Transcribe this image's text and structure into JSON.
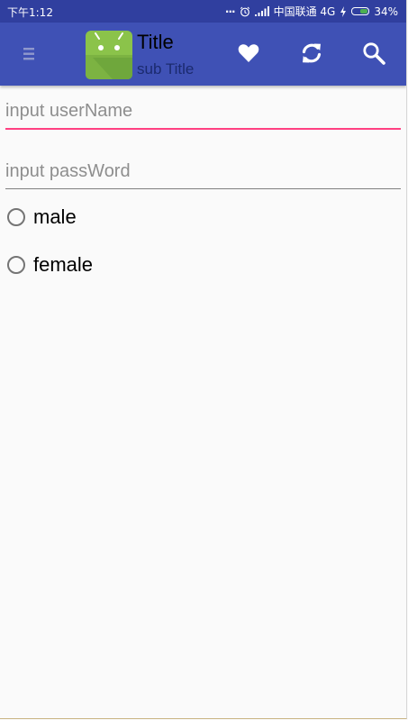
{
  "status_bar": {
    "time": "下午1:12",
    "dots": "...",
    "carrier": "中国联通 4G",
    "battery": "34%",
    "battery_level": 0.34,
    "icons": [
      "alarm-icon",
      "signal-icon",
      "charging-icon",
      "battery-icon"
    ]
  },
  "toolbar": {
    "title": "Title",
    "subtitle": "sub Title",
    "nav_icon": "menu-icon",
    "logo": "android-logo",
    "actions": [
      "heart-icon",
      "refresh-icon",
      "search-icon"
    ]
  },
  "form": {
    "username_placeholder": "input userName",
    "username_value": "",
    "password_placeholder": "input passWord",
    "password_value": "",
    "gender_options": [
      "male",
      "female"
    ]
  },
  "colors": {
    "status_bar": "#303f9f",
    "toolbar": "#3f51b5",
    "accent": "#ff4081",
    "background": "#fafafa"
  }
}
